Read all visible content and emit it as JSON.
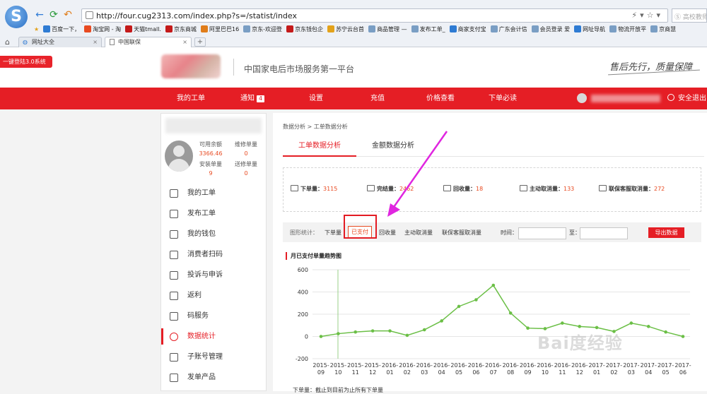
{
  "browser": {
    "url": "http://four.cug2313.com/index.php?s=/statist/index",
    "search_placeholder": "高校教师",
    "bookmarks": [
      "百度一下，",
      "淘宝网 - 淘",
      "天猫tmall.",
      "京东商城",
      "阿里巴巴16",
      "京东-欢迎登",
      "京东钱包企",
      "苏宁云台首",
      "商品管理 —",
      "发布工单_",
      "商家支付宝",
      "广东会计信",
      "会员登录 爱",
      "网址导航",
      "物流开放平",
      "京商慧"
    ],
    "tabs": [
      {
        "label": "网址大全",
        "active": false
      },
      {
        "label": "中国联保",
        "active": true
      }
    ]
  },
  "header": {
    "onekey": "一键登陆3.0系统",
    "slogan": "中国家电后市场服务第一平台",
    "signature": "售后先行，质量保障"
  },
  "nav": {
    "items": [
      "我的工单",
      "通知",
      "设置",
      "充值",
      "价格查看",
      "下单必读"
    ],
    "notify_count": "4",
    "logout": "安全退出"
  },
  "sidebar": {
    "stats": [
      {
        "label": "可用余额",
        "value": "3366.46"
      },
      {
        "label": "维修单量",
        "value": "0"
      },
      {
        "label": "安装单量",
        "value": "9"
      },
      {
        "label": "送修单量",
        "value": "0"
      }
    ],
    "menu": [
      {
        "label": "我的工单",
        "icon": "list-icon"
      },
      {
        "label": "发布工单",
        "icon": "edit-icon"
      },
      {
        "label": "我的钱包",
        "icon": "wallet-icon"
      },
      {
        "label": "消费者扫码",
        "icon": "scan-icon"
      },
      {
        "label": "投诉与申诉",
        "icon": "alert-icon"
      },
      {
        "label": "返利",
        "icon": "coins-icon"
      },
      {
        "label": "码服务",
        "icon": "qrcode-icon"
      },
      {
        "label": "数据统计",
        "icon": "pie-chart-icon",
        "active": true
      },
      {
        "label": "子账号管理",
        "icon": "users-icon"
      },
      {
        "label": "发单产品",
        "icon": "grid-icon"
      }
    ]
  },
  "content": {
    "breadcrumb": "数据分析 > 工单数据分析",
    "tabs": [
      "工单数据分析",
      "金额数据分析"
    ],
    "summary": [
      {
        "label": "下单量：",
        "value": "3115"
      },
      {
        "label": "完结量：",
        "value": "2462"
      },
      {
        "label": "回收量：",
        "value": "18"
      },
      {
        "label": "主动取消量：",
        "value": "133"
      },
      {
        "label": "联保客服取消量：",
        "value": "272"
      }
    ],
    "filter": {
      "label": "图形统计：",
      "options": [
        "下单量",
        "已支付",
        "回收量",
        "主动取消量",
        "联保客服取消量"
      ],
      "selected": "已支付",
      "time_label": "时间：",
      "to_label": "至：",
      "export": "导出数据"
    },
    "chart_title": "月已支付单量趋势图",
    "bottom_note": "下单量：截止到目前为止所有下单量"
  },
  "watermark": "Bai度经验",
  "colors": {
    "accent": "#e51e25",
    "value": "#e84a21",
    "line": "#6bbf46"
  },
  "chart_data": {
    "type": "line",
    "title": "月已支付单量趋势图",
    "ylim": [
      -200,
      600
    ],
    "yticks": [
      -200,
      0,
      200,
      400,
      600
    ],
    "categories": [
      "2015-09",
      "2015-10",
      "2015-11",
      "2015-12",
      "2016-01",
      "2016-02",
      "2016-03",
      "2016-04",
      "2016-05",
      "2016-06",
      "2016-07",
      "2016-08",
      "2016-09",
      "2016-10",
      "2016-11",
      "2016-12",
      "2017-01",
      "2017-02",
      "2017-03",
      "2017-04",
      "2017-05",
      "2017-06"
    ],
    "values": [
      0,
      25,
      40,
      50,
      50,
      10,
      60,
      140,
      270,
      330,
      460,
      210,
      75,
      70,
      120,
      90,
      80,
      45,
      120,
      90,
      40,
      0
    ]
  }
}
